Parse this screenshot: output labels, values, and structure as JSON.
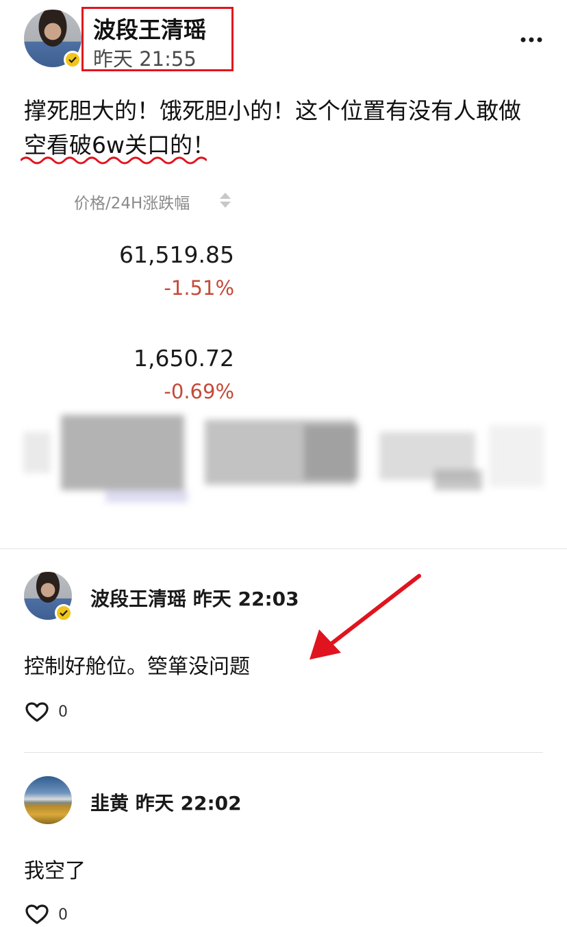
{
  "post": {
    "author": "波段王清瑶",
    "time": "昨天 21:55",
    "text_line1": "撑死胆大的！饿死胆小的！这个位置有没有人敢做",
    "text_line2": "空看破6w关口的！"
  },
  "more_menu": {
    "icon": "more-dots-icon"
  },
  "prices": {
    "header": "价格/24H涨跌幅",
    "items": [
      {
        "price": "61,519.85",
        "change": "-1.51%"
      },
      {
        "price": "1,650.72",
        "change": "-0.69%"
      }
    ]
  },
  "comments": [
    {
      "author": "波段王清瑶",
      "time": "昨天 22:03",
      "text": "控制好舱位。箜箪没问题",
      "likes": "0"
    },
    {
      "author": "韭黄",
      "time": "昨天 22:02",
      "text": "我空了",
      "likes": "0"
    }
  ],
  "colors": {
    "highlight": "#e0141e",
    "negative": "#c44a39",
    "badge": "#f2c51a"
  }
}
